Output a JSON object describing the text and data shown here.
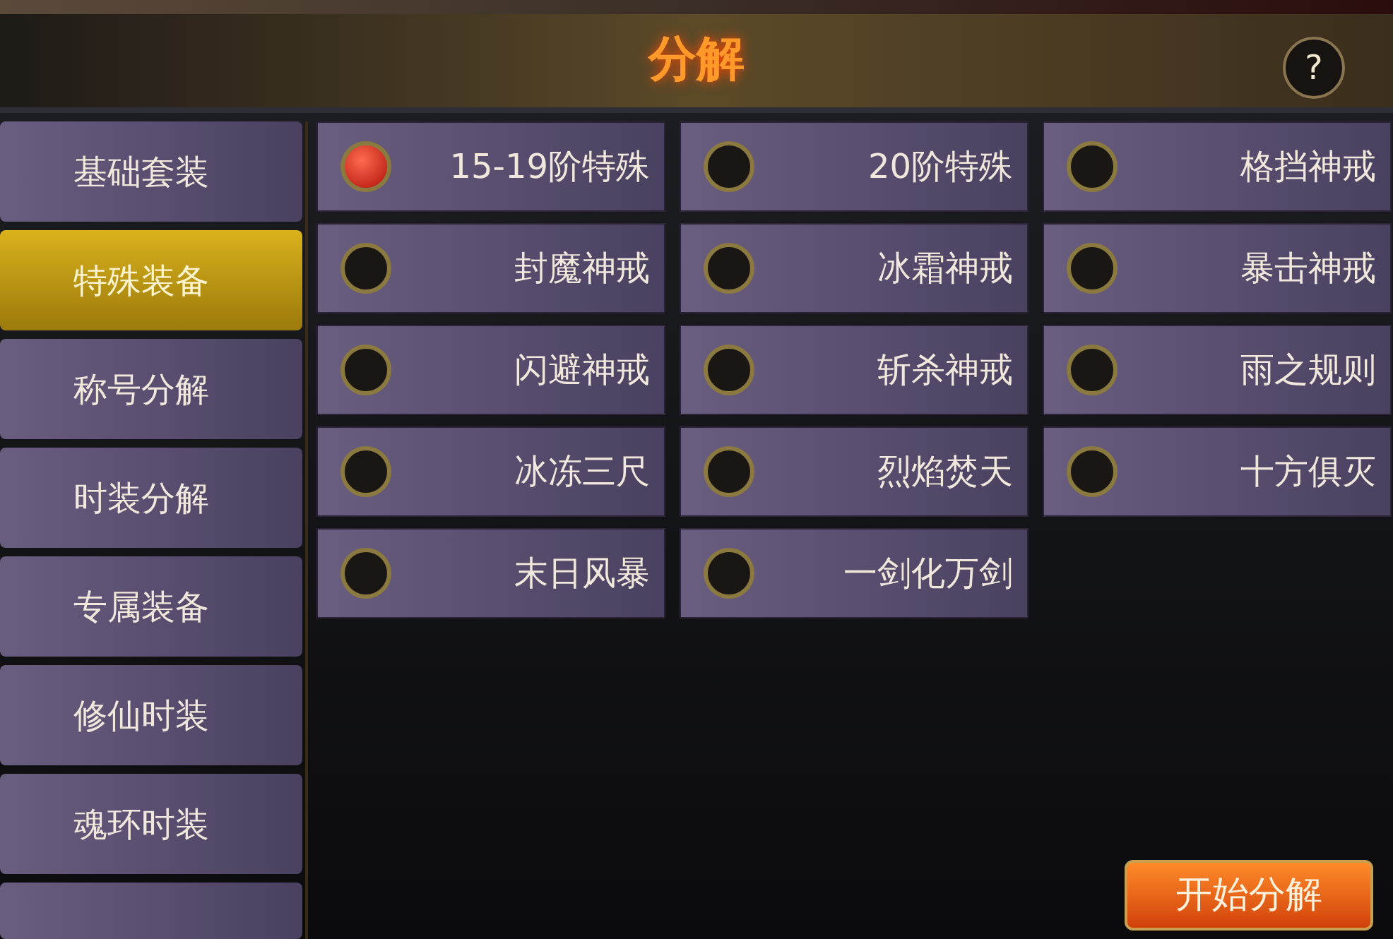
{
  "header": {
    "title": "分解",
    "help": "?"
  },
  "sidebar": {
    "items": [
      {
        "label": "基础套装",
        "selected": false
      },
      {
        "label": "特殊装备",
        "selected": true
      },
      {
        "label": "称号分解",
        "selected": false
      },
      {
        "label": "时装分解",
        "selected": false
      },
      {
        "label": "专属装备",
        "selected": false
      },
      {
        "label": "修仙时装",
        "selected": false
      },
      {
        "label": "魂环时装",
        "selected": false
      }
    ]
  },
  "options": [
    {
      "label": "15-19阶特殊",
      "selected": true
    },
    {
      "label": "20阶特殊",
      "selected": false
    },
    {
      "label": "格挡神戒",
      "selected": false
    },
    {
      "label": "封魔神戒",
      "selected": false
    },
    {
      "label": "冰霜神戒",
      "selected": false
    },
    {
      "label": "暴击神戒",
      "selected": false
    },
    {
      "label": "闪避神戒",
      "selected": false
    },
    {
      "label": "斩杀神戒",
      "selected": false
    },
    {
      "label": "雨之规则",
      "selected": false
    },
    {
      "label": "冰冻三尺",
      "selected": false
    },
    {
      "label": "烈焰焚天",
      "selected": false
    },
    {
      "label": "十方俱灭",
      "selected": false
    },
    {
      "label": "末日风暴",
      "selected": false
    },
    {
      "label": "一剑化万剑",
      "selected": false
    }
  ],
  "start_button": "开始分解"
}
